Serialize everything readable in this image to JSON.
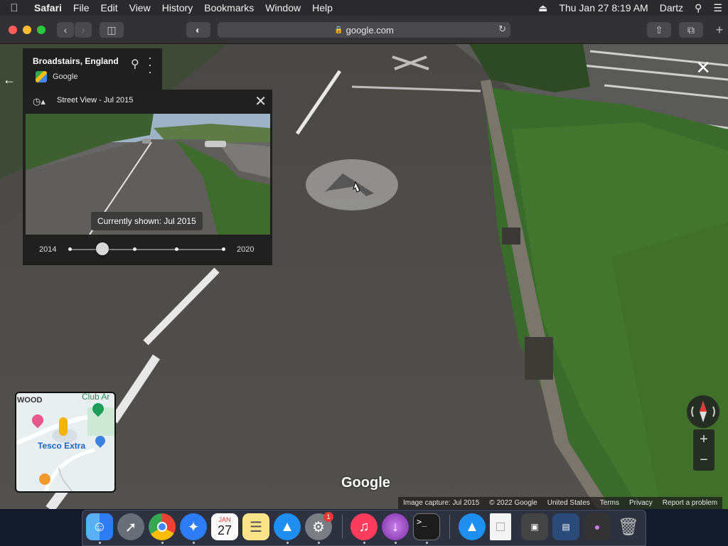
{
  "menubar": {
    "apple_icon": "apple-logo",
    "items": [
      "Safari",
      "File",
      "Edit",
      "View",
      "History",
      "Bookmarks",
      "Window",
      "Help"
    ],
    "clock": "Thu Jan 27  8:19 AM",
    "user": "Dartz",
    "status_icons": [
      "eject-icon",
      "search-icon",
      "list-icon"
    ]
  },
  "toolbar": {
    "url": "google.com",
    "icons": [
      "back-icon",
      "forward-icon",
      "sidebar-icon",
      "privacy-shield-icon",
      "lock-icon",
      "reload-icon",
      "share-icon",
      "tabs-icon",
      "new-tab-icon"
    ]
  },
  "streetview": {
    "place": "Broadstairs, England",
    "provider": "Google",
    "panel_title": "Street View - Jul 2015",
    "tooltip": "Currently shown: Jul 2015",
    "year_start": "2014",
    "year_end": "2020",
    "timeline_position": 0.17,
    "timeline_ticks": 5,
    "logo": "Google"
  },
  "minimap": {
    "labels": [
      "WOOD",
      "Club Ar",
      "Tesco Extra"
    ]
  },
  "attribution": [
    "Image capture: Jul 2015",
    "© 2022 Google",
    "United States",
    "Terms",
    "Privacy",
    "Report a problem"
  ],
  "dock": {
    "apps": [
      "Finder",
      "Launchpad",
      "Chrome",
      "Safari",
      "Calendar",
      "Notes",
      "App Store",
      "System Preferences",
      "Music",
      "Installer",
      "Terminal",
      "App Store",
      "Document",
      "Screenshot",
      "Display",
      "Preview",
      "Trash"
    ],
    "calendar_month": "JAN",
    "calendar_day": "27",
    "badge": "1",
    "colors": {
      "accent": "#2d7cf6",
      "music": "#fb3c5c",
      "chrome_green": "#34a853"
    }
  }
}
